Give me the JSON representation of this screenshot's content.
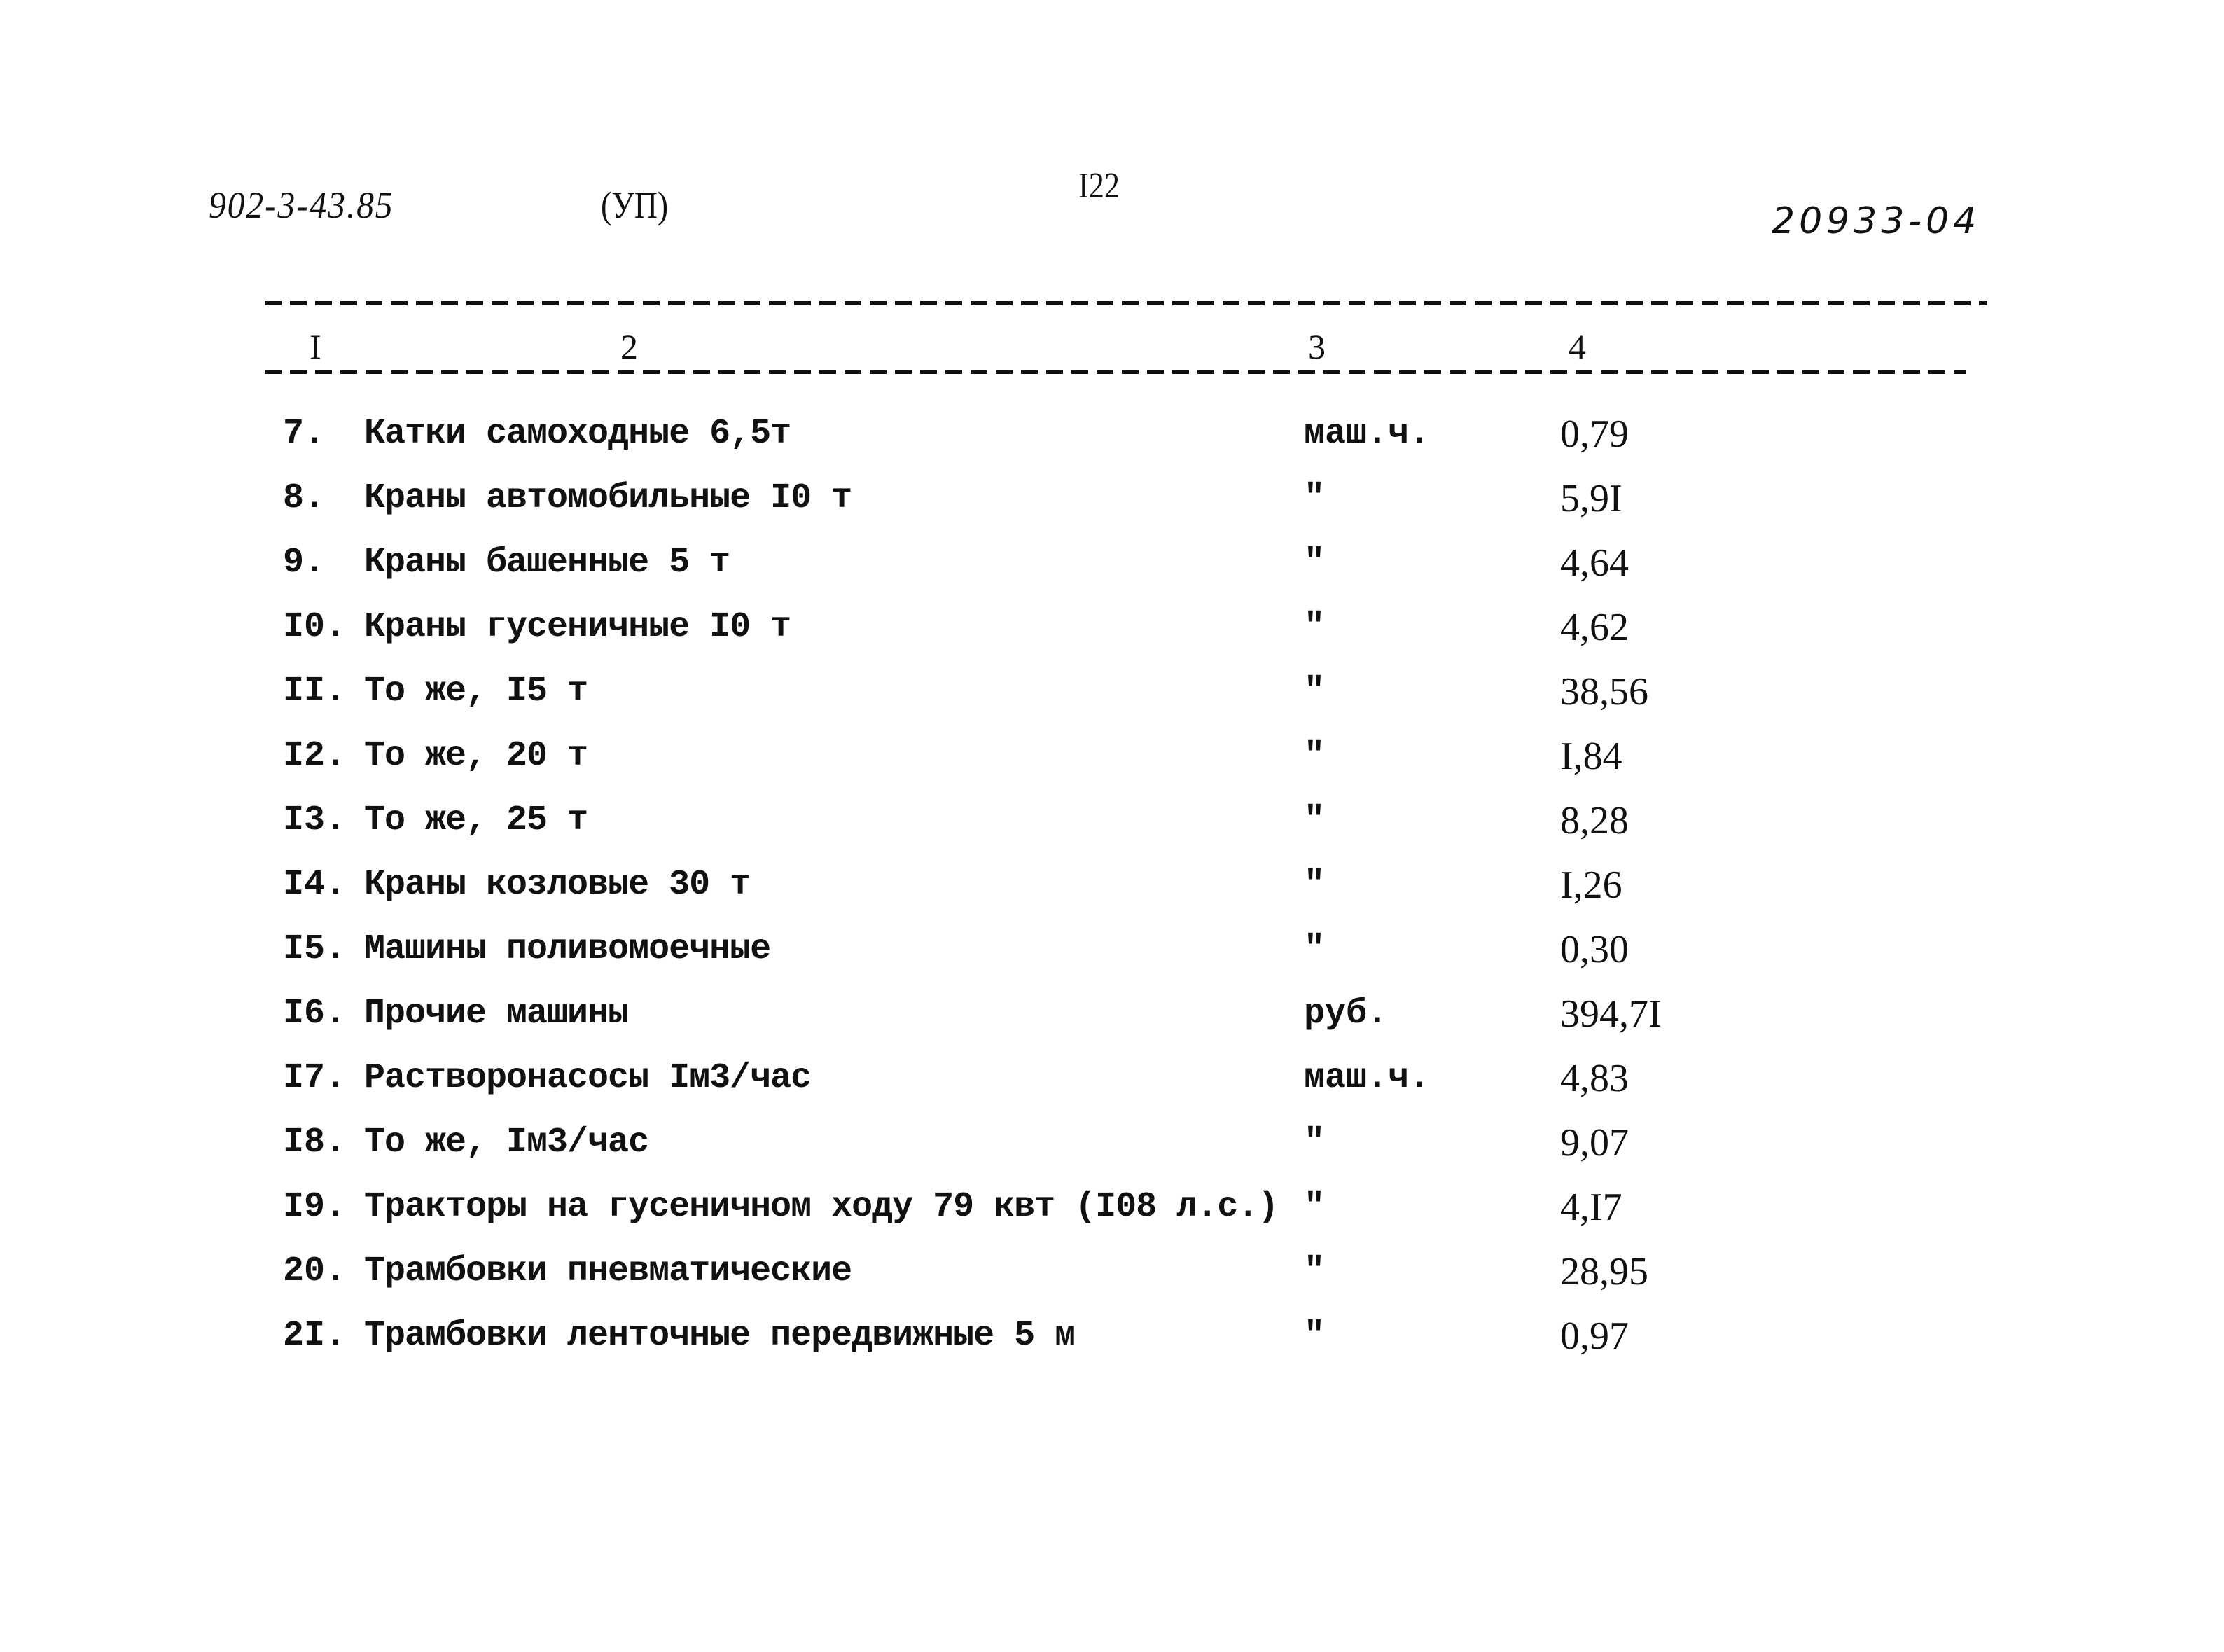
{
  "header": {
    "document_code": "902-3-43.85",
    "section": "(УП)",
    "page_number": "I22",
    "archive_number": "20933-04"
  },
  "table": {
    "column_headers": [
      "I",
      "2",
      "3",
      "4"
    ],
    "rows": [
      {
        "num": "7.",
        "name": "Катки самоходные 6,5т",
        "unit": "маш.ч.",
        "value": "0,79"
      },
      {
        "num": "8.",
        "name": "Краны автомобильные I0 т",
        "unit": "\"",
        "value": "5,9I"
      },
      {
        "num": "9.",
        "name": "Краны башенные 5 т",
        "unit": "\"",
        "value": "4,64"
      },
      {
        "num": "I0.",
        "name": "Краны гусеничные I0 т",
        "unit": "\"",
        "value": "4,62"
      },
      {
        "num": "II.",
        "name": "То же, I5 т",
        "unit": "\"",
        "value": "38,56"
      },
      {
        "num": "I2.",
        "name": "То же, 20 т",
        "unit": "\"",
        "value": "I,84"
      },
      {
        "num": "I3.",
        "name": "То же, 25 т",
        "unit": "\"",
        "value": "8,28"
      },
      {
        "num": "I4.",
        "name": "Краны козловые 30 т",
        "unit": "\"",
        "value": "I,26"
      },
      {
        "num": "I5.",
        "name": "Машины поливомоечные",
        "unit": "\"",
        "value": "0,30"
      },
      {
        "num": "I6.",
        "name": "Прочие машины",
        "unit": "руб.",
        "value": "394,7I"
      },
      {
        "num": "I7.",
        "name": "Растворонасосы Iм3/час",
        "unit": "маш.ч.",
        "value": "4,83"
      },
      {
        "num": "I8.",
        "name": "То же, Iм3/час",
        "unit": "\"",
        "value": "9,07"
      },
      {
        "num": "I9.",
        "name": "Тракторы на гусеничном ходу 79 квт (I08 л.с.)",
        "unit": "\"",
        "value": "4,I7"
      },
      {
        "num": "20.",
        "name": "Трамбовки пневматические",
        "unit": "\"",
        "value": "28,95"
      },
      {
        "num": "2I.",
        "name": "Трамбовки ленточные передвижные 5 м",
        "unit": "\"",
        "value": "0,97"
      }
    ]
  }
}
